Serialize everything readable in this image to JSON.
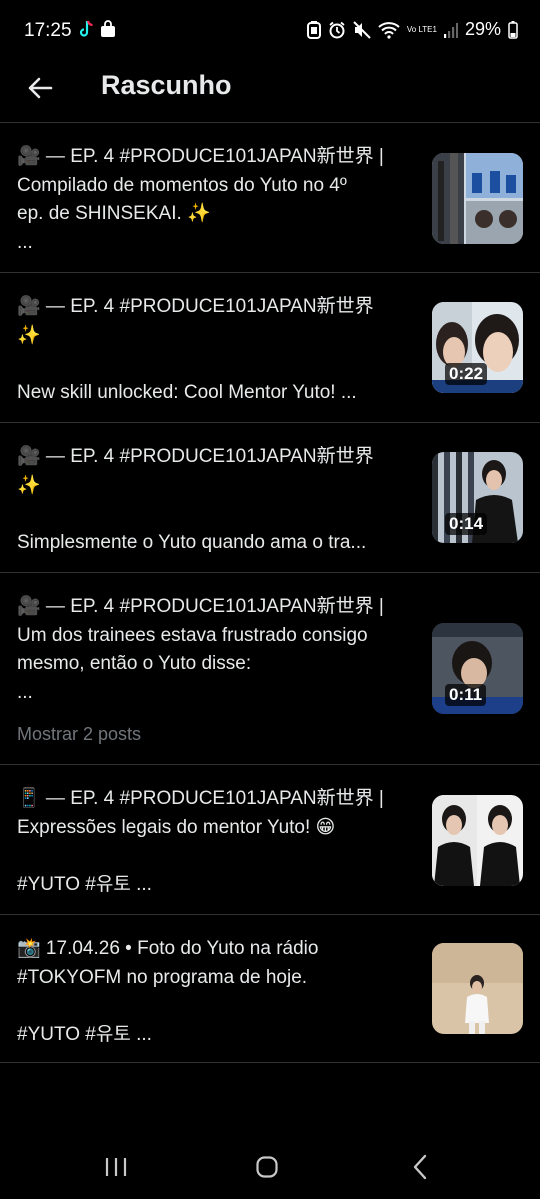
{
  "status_bar": {
    "time": "17:25",
    "battery": "29%",
    "network": "Vo LTE1",
    "left_icons": [
      "tiktok-icon",
      "shopping-bag-icon"
    ],
    "right_icons": [
      "bluetooth-battery-icon",
      "alarm-icon",
      "mute-icon",
      "wifi-icon",
      "signal-icon",
      "battery-icon"
    ]
  },
  "header": {
    "title": "Rascunho"
  },
  "drafts": [
    {
      "text": "🎥 — EP. 4 #PRODUCE101JAPAN新世界 |\nCompilado de momentos do Yuto no 4º\nep. de SHINSEKAI. ✨\n...",
      "duration": ""
    },
    {
      "text": "🎥 — EP. 4 #PRODUCE101JAPAN新世界\n✨\n\nNew skill unlocked: Cool Mentor Yuto! ...",
      "duration": "0:22"
    },
    {
      "text": "🎥 — EP. 4 #PRODUCE101JAPAN新世界\n✨\n\nSimplesmente o Yuto quando ama o tra...",
      "duration": "0:14"
    },
    {
      "text": "🎥 — EP. 4 #PRODUCE101JAPAN新世界 |\nUm dos trainees estava frustrado consigo\nmesmo, então o Yuto disse:\n...",
      "duration": "0:11",
      "show_more": "Mostrar 2 posts"
    },
    {
      "text": "📱 — EP. 4 #PRODUCE101JAPAN新世界 |\nExpressões legais do mentor Yuto! 😁\n\n#YUTO #유토 ...",
      "duration": ""
    },
    {
      "text": "📸 17.04.26 • Foto do Yuto na rádio\n#TOKYOFM no programa de hoje.\n\n#YUTO #유토 ...",
      "duration": ""
    }
  ],
  "colors": {
    "background": "#000000",
    "text": "#e7e9ea",
    "muted": "#71767b",
    "divider": "#2f3336"
  },
  "nav_icons": [
    "recent-apps-icon",
    "home-icon",
    "back-nav-icon"
  ]
}
